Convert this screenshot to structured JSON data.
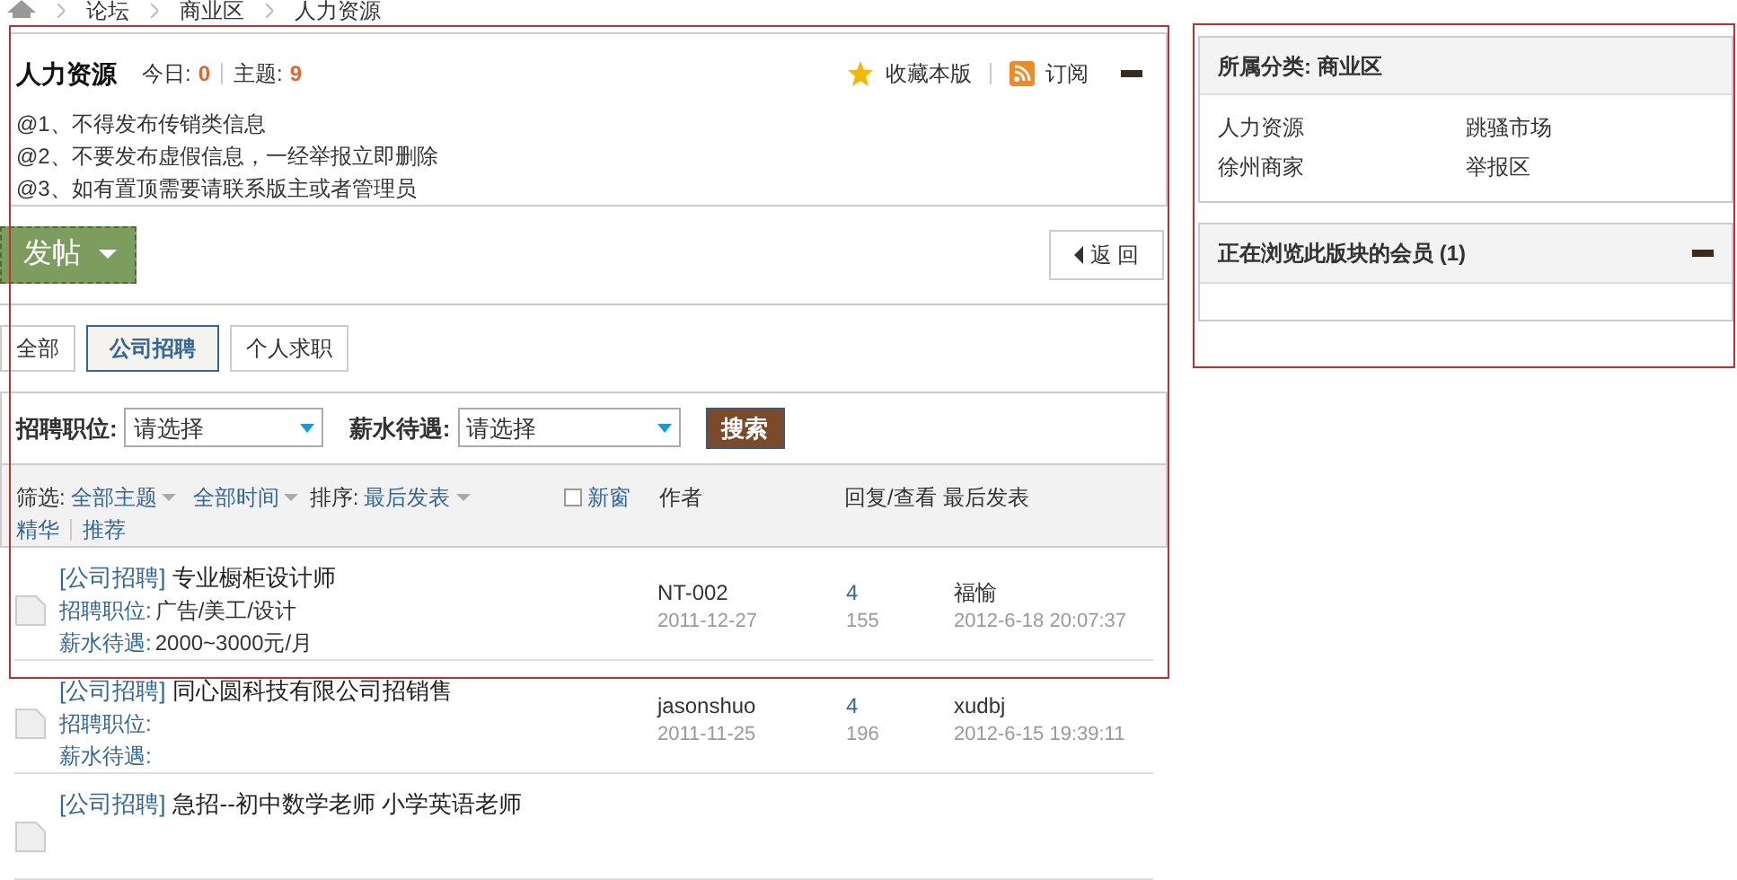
{
  "breadcrumb": [
    "论坛",
    "商业区",
    "人力资源"
  ],
  "forum": {
    "title": "人力资源",
    "today_label": "今日:",
    "today": "0",
    "topics_label": "主题:",
    "topics": "9",
    "favorite": "收藏本版",
    "subscribe": "订阅"
  },
  "rules": [
    "@1、不得发布传销类信息",
    "@2、不要发布虚假信息，一经举报立即删除",
    "@3、如有置顶需要请联系版主或者管理员"
  ],
  "post_button": "发帖",
  "back_button": "返 回",
  "tabs": [
    {
      "label": "全部",
      "selected": false
    },
    {
      "label": "公司招聘",
      "selected": true
    },
    {
      "label": "个人求职",
      "selected": false
    }
  ],
  "search_filters": [
    {
      "label": "招聘职位:",
      "value": "请选择"
    },
    {
      "label": "薪水待遇:",
      "value": "请选择"
    }
  ],
  "search_button": "搜索",
  "thread_header": {
    "filter_label": "筛选:",
    "filters": [
      "全部主题",
      "全部时间"
    ],
    "sort_label": "排序:",
    "sort": "最后发表",
    "links": [
      "精华",
      "推荐"
    ],
    "new_window": {
      "label": "新窗",
      "checked": false
    },
    "columns": [
      "作者",
      "回复/查看",
      "最后发表"
    ]
  },
  "threads": [
    {
      "category": "[公司招聘]",
      "title": "专业橱柜设计师",
      "fields": [
        {
          "label": "招聘职位:",
          "value": "广告/美工/设计"
        },
        {
          "label": "薪水待遇:",
          "value": "2000~3000元/月"
        }
      ],
      "author": "NT-002",
      "date": "2011-12-27",
      "replies": "4",
      "views": "155",
      "last_user": "福愉",
      "last_time": "2012-6-18 20:07:37"
    },
    {
      "category": "[公司招聘]",
      "title": "同心圆科技有限公司招销售",
      "fields": [
        {
          "label": "招聘职位:"
        },
        {
          "label": "薪水待遇:"
        }
      ],
      "author": "jasonshuo",
      "date": "2011-11-25",
      "replies": "4",
      "views": "196",
      "last_user": "xudbj",
      "last_time": "2012-6-15 19:39:11"
    },
    {
      "category": "[公司招聘]",
      "title": "急招--初中数学老师 小学英语老师"
    }
  ],
  "sidebar": {
    "category_title": "所属分类: 商业区",
    "categories": [
      "人力资源",
      "跳骚市场",
      "徐州商家",
      "举报区"
    ],
    "members_title": "正在浏览此版块的会员 (1)"
  }
}
